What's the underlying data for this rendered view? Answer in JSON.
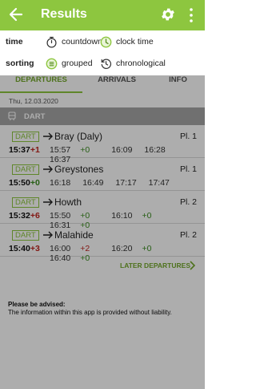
{
  "appbar": {
    "title": "Results"
  },
  "options": {
    "time_label": "time",
    "time_options": [
      "countdown",
      "clock time"
    ],
    "time_selected": "clock time",
    "sorting_label": "sorting",
    "sorting_options": [
      "grouped",
      "chronological"
    ],
    "sorting_selected": "grouped"
  },
  "tabs": [
    "DEPARTURES",
    "ARRIVALS",
    "INFO"
  ],
  "date": "Thu, 12.03.2020",
  "group": "DART",
  "departures": [
    {
      "line": "DART",
      "dest": "Bray (Daly)",
      "platform": "Pl. 1",
      "time": "15:37",
      "delay": "+1",
      "next": [
        {
          "t": "15:57",
          "d": "+0"
        },
        {
          "t": "16:09",
          "d": ""
        },
        {
          "t": "16:28",
          "d": ""
        },
        {
          "t": "16:37",
          "d": ""
        }
      ]
    },
    {
      "line": "DART",
      "dest": "Greystones",
      "platform": "Pl. 1",
      "time": "15:50",
      "delay": "+0",
      "next": [
        {
          "t": "16:18",
          "d": ""
        },
        {
          "t": "16:49",
          "d": ""
        },
        {
          "t": "17:17",
          "d": ""
        },
        {
          "t": "17:47",
          "d": ""
        }
      ]
    },
    {
      "line": "DART",
      "dest": "Howth",
      "platform": "Pl. 2",
      "time": "15:32",
      "delay": "+6",
      "next": [
        {
          "t": "15:50",
          "d": "+0"
        },
        {
          "t": "16:10",
          "d": "+0"
        },
        {
          "t": "16:31",
          "d": "+0"
        }
      ]
    },
    {
      "line": "DART",
      "dest": "Malahide",
      "platform": "Pl. 2",
      "time": "15:40",
      "delay": "+3",
      "next": [
        {
          "t": "16:00",
          "d": "+2"
        },
        {
          "t": "16:20",
          "d": "+0"
        },
        {
          "t": "16:40",
          "d": "+0"
        }
      ]
    }
  ],
  "later": "LATER DEPARTURES",
  "advice": {
    "title": "Please be advised:",
    "body": "The information within this app is provided without liability."
  },
  "colors": {
    "accent": "#8dc63f",
    "delay_ok": "#3a8c20",
    "delay_bad": "#c0261f"
  }
}
